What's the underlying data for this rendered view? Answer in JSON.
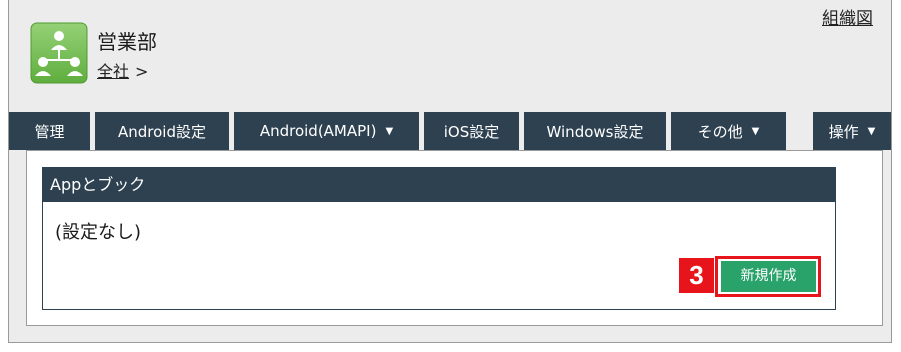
{
  "header": {
    "org_chart_link": "組織図",
    "department_name": "営業部",
    "breadcrumb": {
      "root_link": "全社",
      "separator": ">"
    }
  },
  "tabs": [
    {
      "label": "管理",
      "has_dropdown": false
    },
    {
      "label": "Android設定",
      "has_dropdown": false
    },
    {
      "label": "Android(AMAPI)",
      "has_dropdown": true
    },
    {
      "label": "iOS設定",
      "has_dropdown": false
    },
    {
      "label": "Windows設定",
      "has_dropdown": false
    },
    {
      "label": "その他",
      "has_dropdown": true
    },
    {
      "label": "操作",
      "has_dropdown": true
    }
  ],
  "tab_caret": "▼",
  "section": {
    "title": "Appとブック",
    "empty_message": "(設定なし)",
    "new_button_label": "新規作成"
  },
  "annotation": {
    "step_number": "3"
  },
  "icons": {
    "department": "department-org-icon",
    "dropdown": "caret-down-icon"
  },
  "colors": {
    "tab_bar": "#2e4150",
    "section_header": "#2e4150",
    "primary_button": "#29a36a",
    "highlight_red": "#e8141b",
    "page_background": "#ececec",
    "icon_green": "#7cc25a"
  }
}
